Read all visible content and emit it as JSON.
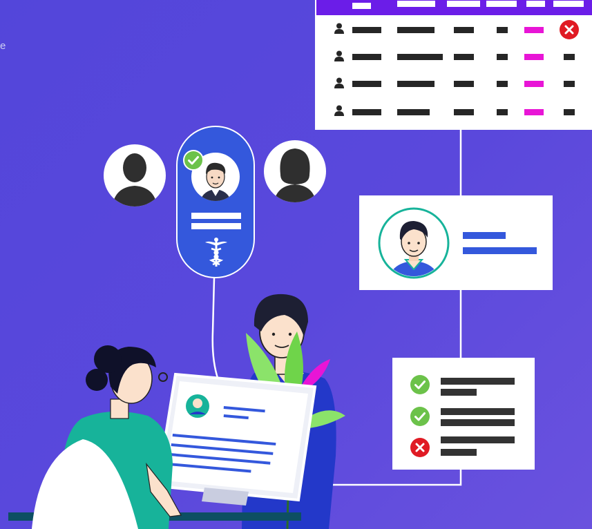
{
  "edge_text": "e",
  "colors": {
    "background": "#5648da",
    "table_header": "#6b1de8",
    "accent_magenta": "#e815d6",
    "check_green": "#6cc24a",
    "reject_red": "#e01b24",
    "card_blue": "#3458dc",
    "teal": "#17b39a"
  },
  "icons": {
    "reject": "x-circle-icon",
    "approve": "check-circle-icon",
    "medical": "caduceus-icon",
    "person": "person-icon"
  },
  "checklist": [
    {
      "status": "approved",
      "icon": "check-circle-icon"
    },
    {
      "status": "approved",
      "icon": "check-circle-icon"
    },
    {
      "status": "rejected",
      "icon": "x-circle-icon"
    }
  ]
}
